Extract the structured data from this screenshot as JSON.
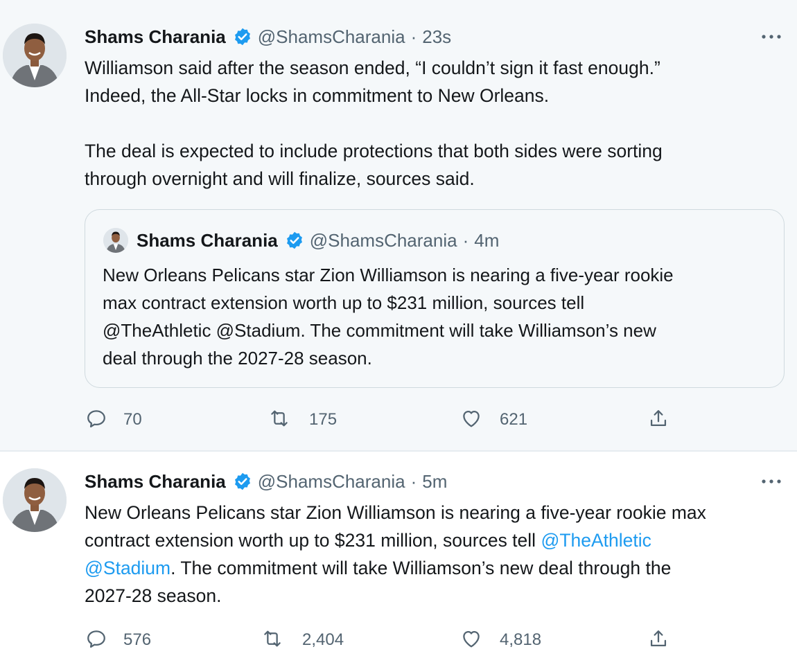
{
  "tweets": [
    {
      "author_name": "Shams Charania",
      "handle": "@ShamsCharania",
      "separator": "·",
      "time": "23s",
      "paragraph1_line1": "Williamson said after the season ended, “I couldn’t sign it fast enough.”",
      "paragraph1_line2": "Indeed, the All-Star locks in commitment to New Orleans.",
      "paragraph2_line1": "The deal is expected to include protections that both sides were sorting",
      "paragraph2_line2": "through overnight and will finalize, sources said.",
      "quoted": {
        "author_name": "Shams Charania",
        "handle": "@ShamsCharania",
        "separator": "·",
        "time": "4m",
        "line1": "New Orleans Pelicans star Zion Williamson is nearing a five-year rookie",
        "line2": "max contract extension worth up to $231 million, sources tell",
        "line3": "@TheAthletic @Stadium. The commitment will take Williamson’s new",
        "line4": "deal through the 2027-28 season."
      },
      "replies": "70",
      "retweets": "175",
      "likes": "621"
    },
    {
      "author_name": "Shams Charania",
      "handle": "@ShamsCharania",
      "separator": "·",
      "time": "5m",
      "line1": "New Orleans Pelicans star Zion Williamson is nearing a five-year rookie max",
      "line2_text": "contract extension worth up to $231 million, sources tell ",
      "line2_link": "@TheAthletic",
      "line3_link": "@Stadium",
      "line3_text": ". The commitment will take Williamson’s new deal through the",
      "line4": "2027-28 season.",
      "replies": "576",
      "retweets": "2,404",
      "likes": "4,818"
    }
  ],
  "icons": {
    "verified": "verified-badge-icon",
    "more": "more-options-icon",
    "reply": "reply-icon",
    "retweet": "retweet-icon",
    "like": "like-icon",
    "share": "share-icon"
  },
  "colors": {
    "verified_blue": "#1d9bf0",
    "link_blue": "#1d9bf0",
    "secondary_text": "#536471",
    "primary_text": "#14171a"
  }
}
